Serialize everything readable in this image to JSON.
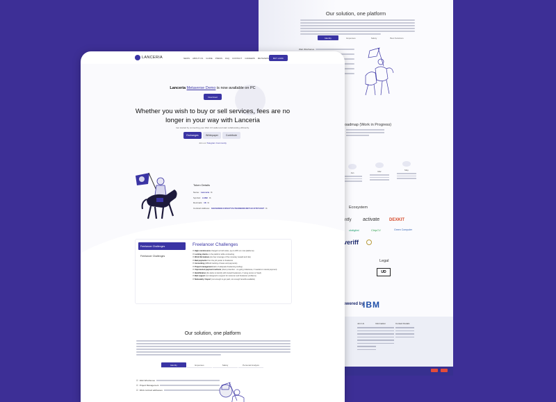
{
  "back_page": {
    "solution_title": "Our solution, one platform",
    "tabs": [
      "Identity",
      "Expenses",
      "Safety",
      "Best Solutions"
    ],
    "list_items": [
      "Web Wireframes",
      "Project Management",
      "Work Contracts"
    ],
    "roadmap_title": "Roadmap (Work in Progress)",
    "roadmap_steps": [
      "Jan",
      "Mar",
      "May",
      "Sep"
    ],
    "ecosystem_title": "Ecosystem",
    "ecosystem_logos": [
      "ntfy",
      "activate",
      "DEXKIT",
      "ckdigital",
      "ChipCV",
      "Green Computer",
      "veriff"
    ],
    "legal_title": "Legal",
    "powered_text": "Powered by",
    "ibm_text": "IBM",
    "footer_headings": [
      "Join Us",
      "Information",
      "Contact Details"
    ]
  },
  "nav": {
    "logo_text": "LANCERIA",
    "menu": [
      "NEWS",
      "ABOUT US",
      "GUIDE",
      "PRESS",
      "FAQ",
      "CONTACT",
      "CAREERS",
      "METAVERSE"
    ],
    "buy_label": "BUY LANC"
  },
  "hero": {
    "announce_prefix": "Lanceria",
    "announce_link": "Metaverse Demo",
    "announce_suffix": "is now available on PC",
    "download_label": "Download",
    "headline": "Whether you wish to buy or sell services, fees are no longer in your way with Lanceria",
    "subline": "Get started by connecting your Web 3.0 wallet and start collaborating efficiently.",
    "ctas": [
      "Exchanges",
      "Whitepaper",
      "Contribute"
    ],
    "telegram_prefix": "Join our",
    "telegram_link": "Telegram Community"
  },
  "token": {
    "title": "Token Details",
    "rows": [
      {
        "label": "Name:",
        "value": "Lanceria"
      },
      {
        "label": "Symbol:",
        "value": "LANC"
      },
      {
        "label": "Decimals:",
        "value": "18"
      },
      {
        "label": "Contract Address:",
        "value": "0xDAE6B91C4FE277AC7B48B930168711C1F7D7A627"
      }
    ]
  },
  "challenges": {
    "tabs": [
      "Freelancer Challenges",
      "Freelancer Challenges"
    ],
    "title": "Freelancer Challenges",
    "rows": [
      {
        "b": "High commissions",
        "t": "charged on both sides, (up to 20% on most platforms)"
      },
      {
        "b": "Locking clients",
        "t": "on the platform while contracting"
      },
      {
        "b": "Work life balance",
        "t": "(too few coverage of the monetary reward and risk)"
      },
      {
        "b": "Bad payments",
        "t": "from the job poster to freelancer"
      },
      {
        "b": "Accounting",
        "t": "(difficult tracking of taxes and payments)"
      },
      {
        "b": "Project management",
        "t": "(lack of adequate freelancing tooling)"
      },
      {
        "b": "Unprotected payment methods",
        "t": "(client protection - on-going milestones, if needed or cancel payment)"
      },
      {
        "b": "Identification",
        "t": "(the lacks to identify with trusted freelancers, if using scores or fraud)"
      },
      {
        "b": "Bad support",
        "t": "(not designed to support for customer and freelancer problems)"
      },
      {
        "b": "Noticeably / Import",
        "t": "(not enough to get paid, not enough benefits available)"
      }
    ]
  },
  "solution": {
    "title": "Our solution, one platform",
    "tabs": [
      "Identity",
      "Expenses",
      "Safety",
      "Personal Analysis"
    ],
    "list": [
      "Web Wireframes",
      "Project Management",
      "Work contract addresses"
    ]
  },
  "colors": {
    "brand": "#3a34a4",
    "background": "#3d2f96"
  }
}
